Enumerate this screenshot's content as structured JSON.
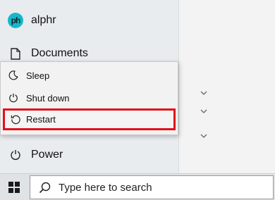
{
  "account": {
    "name": "alphr",
    "avatar_text": "ph"
  },
  "menu": {
    "documents_label": "Documents",
    "power_label": "Power"
  },
  "power_flyout": {
    "items": [
      {
        "label": "Sleep",
        "icon": "moon-icon"
      },
      {
        "label": "Shut down",
        "icon": "power-icon"
      },
      {
        "label": "Restart",
        "icon": "restart-icon",
        "highlighted": true
      }
    ],
    "highlight_color": "#e0101a"
  },
  "taskbar": {
    "search_placeholder": "Type here to search"
  },
  "colors": {
    "avatar_bg": "#16b8c8",
    "menu_bg": "#e9ecee",
    "flyout_bg": "#f2f2f2"
  }
}
